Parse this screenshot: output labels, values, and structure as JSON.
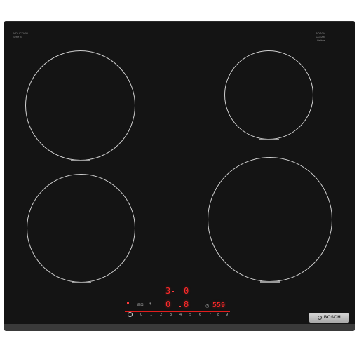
{
  "labels": {
    "top_left_line1": "INDUCTION",
    "top_left_line2": "Serie 4",
    "top_right_line1": "BOSCH",
    "top_right_line2": "CLEAN",
    "top_right_line3": "Lifetime"
  },
  "display": {
    "rear_left_level": "3",
    "rear_right_level": "0",
    "front_left_level": "0",
    "front_right_level": "8",
    "timer": "559"
  },
  "power_scale": [
    "0",
    "1",
    "2",
    "3",
    "4",
    "5",
    "6",
    "7",
    "8",
    "9"
  ],
  "controls": {
    "power_icon": "power-icon",
    "boost_icon": "boost-icon",
    "timer_icon": "timer-icon",
    "lock_icon": "lock-icon"
  },
  "brand": {
    "name": "BOSCH"
  },
  "colors": {
    "glass": "#141414",
    "display_red": "#ff2a2a",
    "ring": "#cfcfcf"
  }
}
